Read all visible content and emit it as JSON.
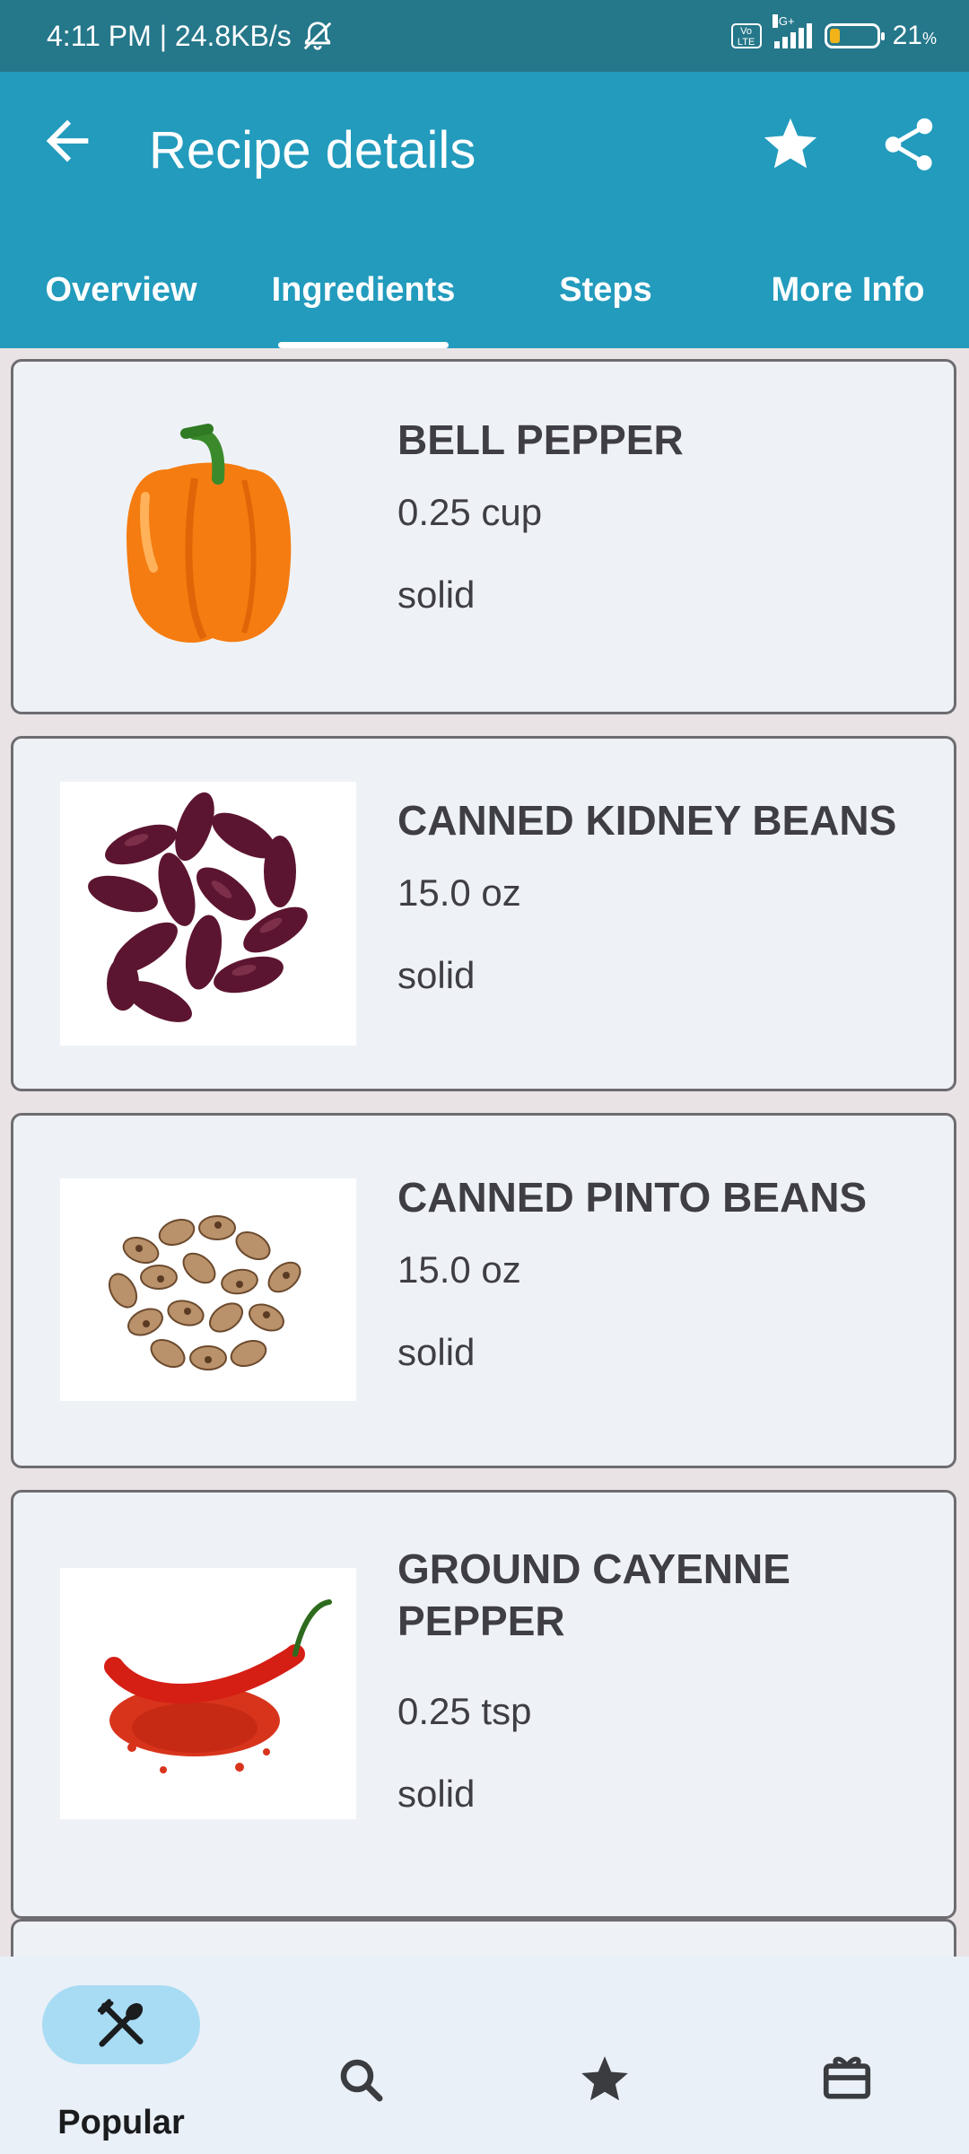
{
  "status_bar": {
    "time_speed": "4:11 PM | 24.8KB/s",
    "network": "4G+",
    "volte": "Vo LTE",
    "battery_percent": "21",
    "battery_unit": "%",
    "battery_level": 0.21
  },
  "app_bar": {
    "title": "Recipe details",
    "icons": [
      "back-arrow-icon",
      "star-icon",
      "share-icon"
    ]
  },
  "tabs": [
    {
      "label": "Overview"
    },
    {
      "label": "Ingredients",
      "active": true
    },
    {
      "label": "Steps"
    },
    {
      "label": "More Info"
    }
  ],
  "ingredients": [
    {
      "name": "BELL PEPPER",
      "amount": "0.25 cup",
      "type": "solid",
      "image": "bell-pepper-image"
    },
    {
      "name": "CANNED KIDNEY BEANS",
      "amount": "15.0 oz",
      "type": "solid",
      "image": "kidney-beans-image"
    },
    {
      "name": "CANNED PINTO BEANS",
      "amount": "15.0 oz",
      "type": "solid",
      "image": "pinto-beans-image"
    },
    {
      "name": "GROUND CAYENNE PEPPER",
      "amount": "0.25 tsp",
      "type": "solid",
      "image": "cayenne-pepper-image"
    }
  ],
  "bottom_nav": {
    "items": [
      {
        "label": "Popular",
        "icon": "fork-spoon-icon",
        "active": true
      },
      {
        "label": "",
        "icon": "search-icon"
      },
      {
        "label": "",
        "icon": "star-icon"
      },
      {
        "label": "",
        "icon": "gift-box-icon"
      }
    ]
  },
  "colors": {
    "status_bar": "#25778a",
    "app_bar": "#229bbd",
    "card_bg": "#eef2f7",
    "nav_active_pill": "#a8dcf4"
  }
}
